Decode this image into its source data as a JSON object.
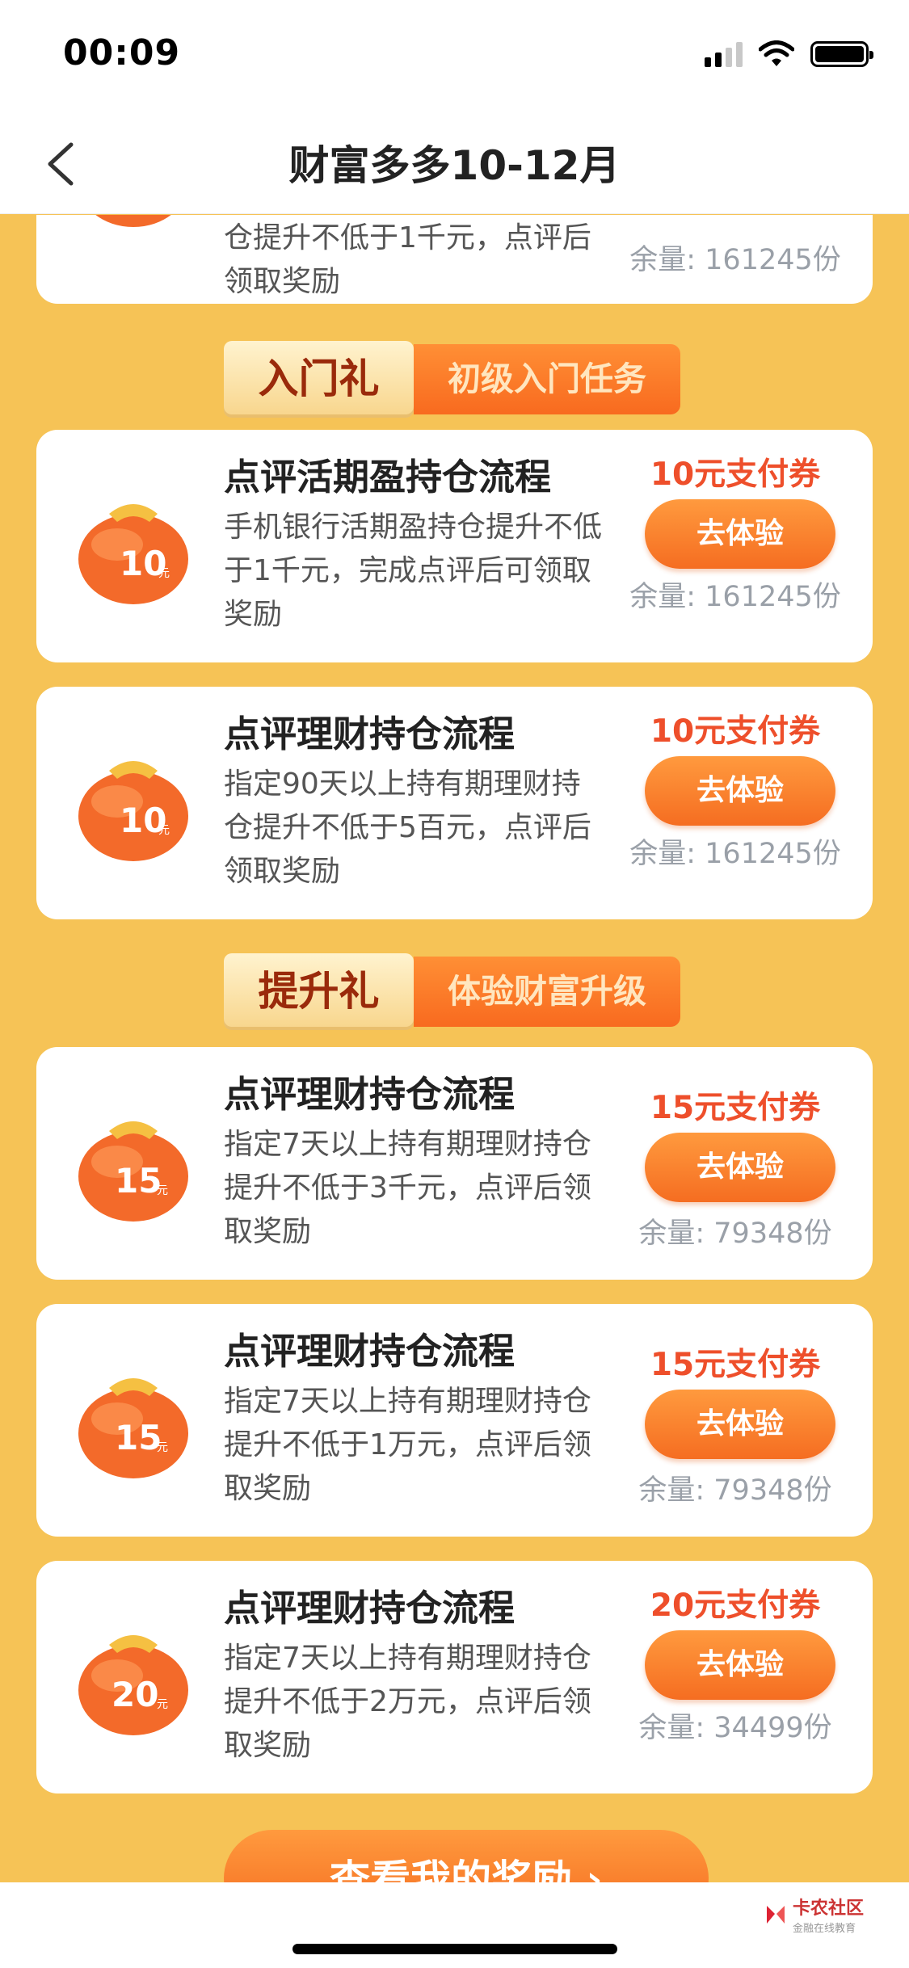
{
  "status_bar": {
    "time": "00:09"
  },
  "nav": {
    "title": "财富多多10-12月"
  },
  "top_partial_card": {
    "desc": "仓提升不低于1千元，点评后领取奖励",
    "stock": "余量: 161245份"
  },
  "sections": [
    {
      "badge": "入门礼",
      "subtitle": "初级入门任务"
    },
    {
      "badge": "提升礼",
      "subtitle": "体验财富升级"
    }
  ],
  "tasks": [
    {
      "icon_amount": "10",
      "icon_unit": "元",
      "title": "点评活期盈持仓流程",
      "desc": "手机银行活期盈持仓提升不低于1千元，完成点评后可领取奖励",
      "reward": "10元支付券",
      "button": "去体验",
      "stock": "余量: 161245份"
    },
    {
      "icon_amount": "10",
      "icon_unit": "元",
      "title": "点评理财持仓流程",
      "desc": "指定90天以上持有期理财持仓提升不低于5百元，点评后领取奖励",
      "reward": "10元支付券",
      "button": "去体验",
      "stock": "余量: 161245份"
    },
    {
      "icon_amount": "15",
      "icon_unit": "元",
      "title": "点评理财持仓流程",
      "desc": "指定7天以上持有期理财持仓提升不低于3千元，点评后领取奖励",
      "reward": "15元支付券",
      "button": "去体验",
      "stock": "余量: 79348份"
    },
    {
      "icon_amount": "15",
      "icon_unit": "元",
      "title": "点评理财持仓流程",
      "desc": "指定7天以上持有期理财持仓提升不低于1万元，点评后领取奖励",
      "reward": "15元支付券",
      "button": "去体验",
      "stock": "余量: 79348份"
    },
    {
      "icon_amount": "20",
      "icon_unit": "元",
      "title": "点评理财持仓流程",
      "desc": "指定7天以上持有期理财持仓提升不低于2万元，点评后领取奖励",
      "reward": "20元支付券",
      "button": "去体验",
      "stock": "余量: 34499份"
    }
  ],
  "bottom": {
    "view_rewards": "查看我的奖励 ›"
  },
  "watermark": {
    "name": "卡农社区",
    "tagline": "金融在线教育"
  },
  "colors": {
    "background": "#f6c356",
    "accent": "#f56d21",
    "reward_text": "#ee4f2b"
  }
}
